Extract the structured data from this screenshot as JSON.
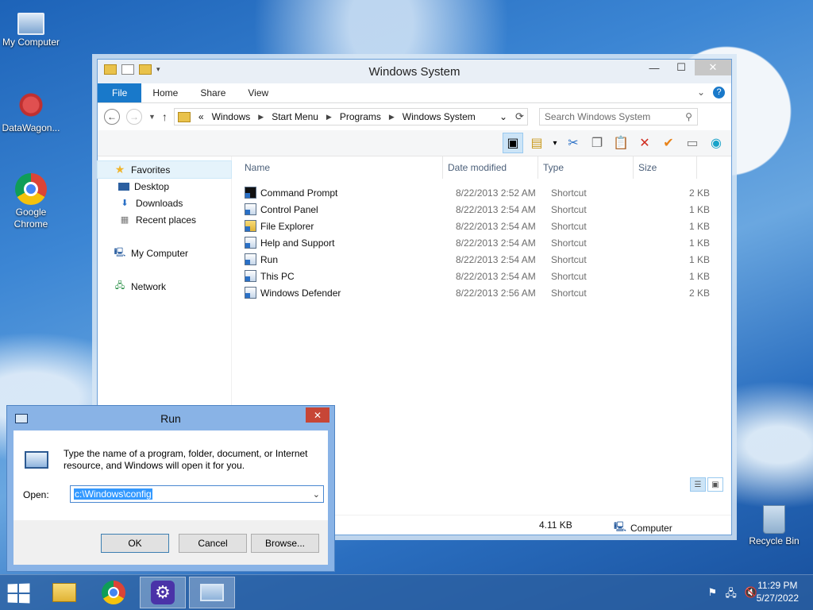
{
  "desktop": {
    "icons": [
      {
        "label": "My Computer"
      },
      {
        "label": "DataWagon..."
      },
      {
        "label": "Google Chrome"
      },
      {
        "label": "Recycle Bin"
      }
    ]
  },
  "explorer": {
    "title": "Windows System",
    "ribbon_tabs": [
      "File",
      "Home",
      "Share",
      "View"
    ],
    "help_label": "?",
    "address": {
      "prefix": "«",
      "crumbs": [
        "Windows",
        "Start Menu",
        "Programs",
        "Windows System"
      ]
    },
    "search": {
      "placeholder": "Search Windows System"
    },
    "nav_pane": {
      "favorites": "Favorites",
      "favorites_items": [
        "Desktop",
        "Downloads",
        "Recent places"
      ],
      "computer": "My Computer",
      "network": "Network"
    },
    "columns": {
      "name": "Name",
      "date": "Date modified",
      "type": "Type",
      "size": "Size"
    },
    "files": [
      {
        "name": "Command Prompt",
        "date": "8/22/2013 2:52 AM",
        "type": "Shortcut",
        "size": "2 KB"
      },
      {
        "name": "Control Panel",
        "date": "8/22/2013 2:54 AM",
        "type": "Shortcut",
        "size": "1 KB"
      },
      {
        "name": "File Explorer",
        "date": "8/22/2013 2:54 AM",
        "type": "Shortcut",
        "size": "1 KB"
      },
      {
        "name": "Help and Support",
        "date": "8/22/2013 2:54 AM",
        "type": "Shortcut",
        "size": "1 KB"
      },
      {
        "name": "Run",
        "date": "8/22/2013 2:54 AM",
        "type": "Shortcut",
        "size": "1 KB"
      },
      {
        "name": "This PC",
        "date": "8/22/2013 2:54 AM",
        "type": "Shortcut",
        "size": "1 KB"
      },
      {
        "name": "Windows Defender",
        "date": "8/22/2013 2:56 AM",
        "type": "Shortcut",
        "size": "2 KB"
      }
    ],
    "status": {
      "size": "4.11 KB",
      "location": "Computer"
    }
  },
  "run_dialog": {
    "title": "Run",
    "description": "Type the name of a program, folder, document, or Internet resource, and Windows will open it for you.",
    "open_label": "Open:",
    "open_value": "c:\\Windows\\config",
    "buttons": {
      "ok": "OK",
      "cancel": "Cancel",
      "browse": "Browse..."
    }
  },
  "taskbar": {
    "clock": {
      "time": "11:29 PM",
      "date": "5/27/2022"
    }
  },
  "colors": {
    "accent": "#1979ca",
    "close_red": "#c74636",
    "selection": "#3399ff"
  }
}
